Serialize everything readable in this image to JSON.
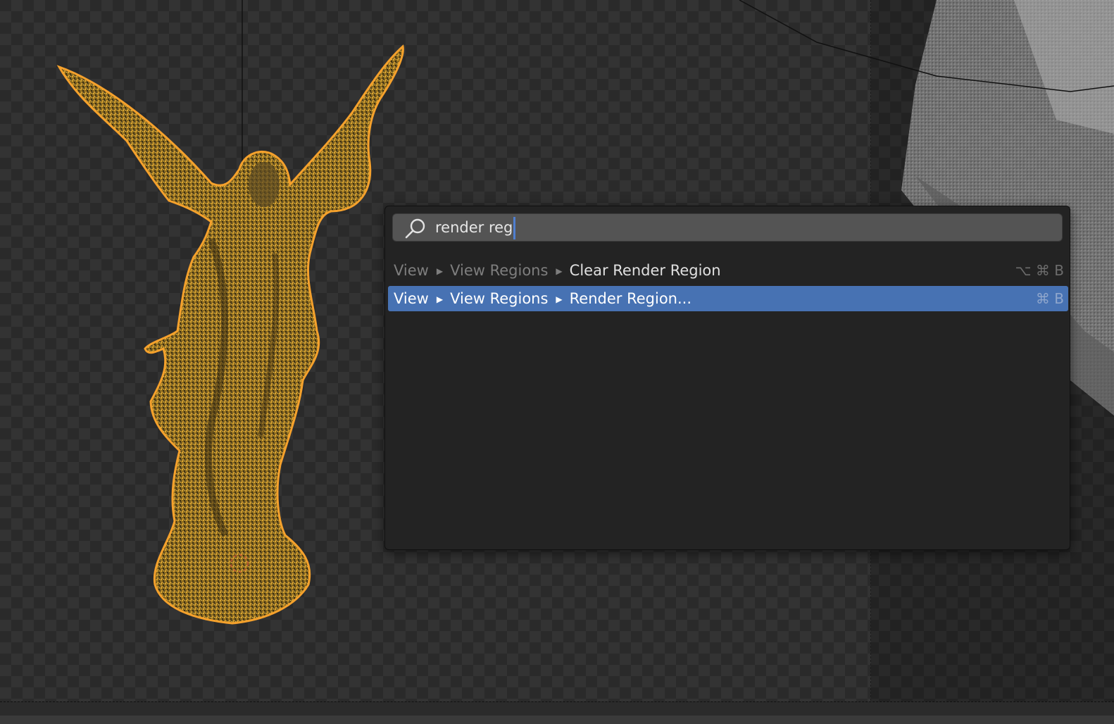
{
  "search": {
    "query": "render reg"
  },
  "results": [
    {
      "path": [
        "View",
        "View Regions"
      ],
      "label": "Clear Render Region",
      "shortcut": "⌥ ⌘ B",
      "selected": false
    },
    {
      "path": [
        "View",
        "View Regions"
      ],
      "label": "Render Region...",
      "shortcut": "⌘ B",
      "selected": true
    }
  ],
  "colors": {
    "selection_outline": "#f5a12c",
    "highlight_row": "#4772b3",
    "popup_bg": "#232323",
    "caret": "#4f7fd0"
  },
  "icons": {
    "search": "search-icon",
    "breadcrumb_separator": "triangle-right-icon"
  }
}
